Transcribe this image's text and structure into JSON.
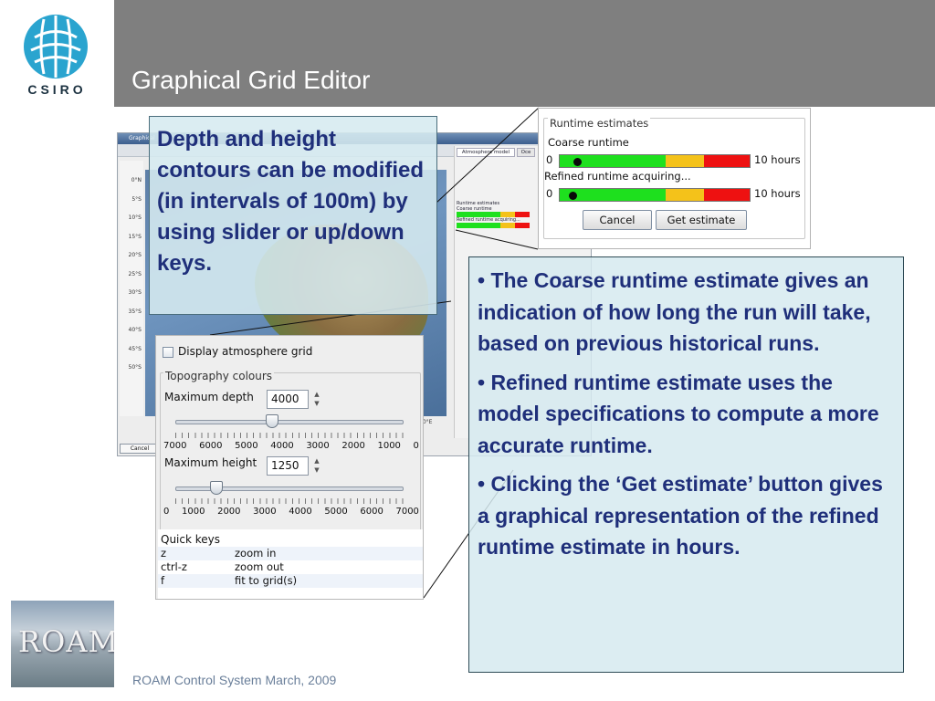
{
  "slide": {
    "title": "Graphical Grid Editor",
    "logo_text": "CSIRO",
    "footer": "ROAM Control System March, 2009",
    "roam_logo_text": "ROAM"
  },
  "depth_callout": {
    "text": "Depth and height contours can be modified (in intervals of 100m) by using slider or up/down keys."
  },
  "runtime_panel": {
    "title": "Runtime estimates",
    "coarse_label": "Coarse runtime",
    "refined_label": "Refined runtime acquiring...",
    "zero_label": "0",
    "max_label": "10 hours",
    "coarse_marker_fraction": 0.07,
    "refined_marker_fraction": 0.05,
    "cancel_label": "Cancel",
    "get_estimate_label": "Get estimate",
    "colors": {
      "green": "#1ee01e",
      "yellow": "#f4c21a",
      "red": "#ee1111"
    }
  },
  "topography_panel": {
    "display_atmosphere_label": "Display atmosphere grid",
    "legend": "Topography colours",
    "max_depth_label": "Maximum depth",
    "max_depth_value": "4000",
    "depth_scale": [
      "7000",
      "6000",
      "5000",
      "4000",
      "3000",
      "2000",
      "1000",
      "0"
    ],
    "max_height_label": "Maximum height",
    "max_height_value": "1250",
    "height_scale": [
      "0",
      "1000",
      "2000",
      "3000",
      "4000",
      "5000",
      "6000",
      "7000"
    ],
    "quick_keys_title": "Quick keys",
    "quick_keys": [
      {
        "key": "z",
        "action": "zoom in"
      },
      {
        "key": "ctrl-z",
        "action": "zoom out"
      },
      {
        "key": "f",
        "action": "fit to grid(s)"
      }
    ]
  },
  "bullets": [
    "• The Coarse runtime estimate gives an indication of how long the run will take, based on previous historical runs.",
    "• Refined runtime estimate uses the model specifications to compute a more accurate runtime.",
    "• Clicking the ‘Get estimate’ button gives a graphical representation of the refined runtime estimate in hours."
  ],
  "app_window": {
    "title": "Graphical",
    "tab_atmosphere": "Atmosphere model",
    "tab_ocean": "Oce",
    "latitudes": [
      "0°N",
      "5°S",
      "10°S",
      "15°S",
      "20°S",
      "25°S",
      "30°S",
      "35°S",
      "40°S",
      "45°S",
      "50°S"
    ],
    "mini_runtime_label": "Runtime estimates",
    "mini_coarse_label": "Coarse runtime",
    "mini_refined_label": "Refined runtime acquiring...",
    "cancel_label": "Cancel",
    "axis_label": "50°E"
  }
}
